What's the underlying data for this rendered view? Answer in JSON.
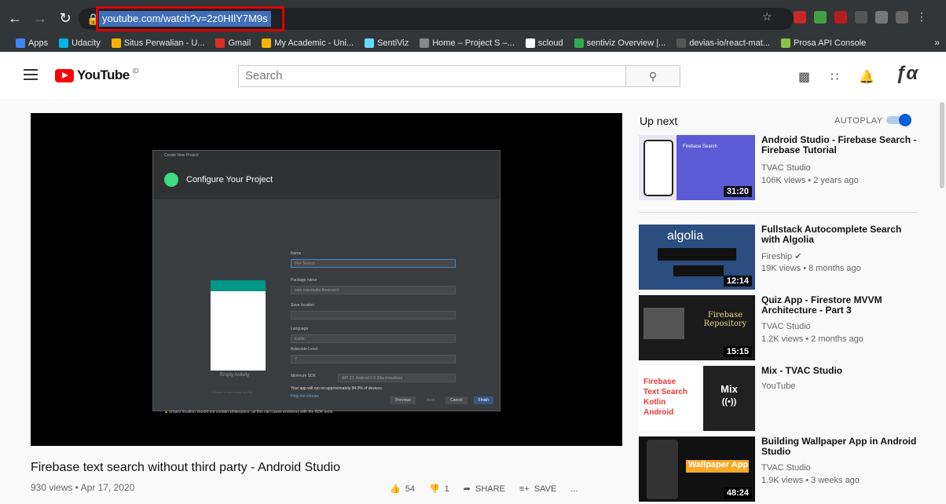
{
  "browser": {
    "url": "youtube.com/watch?v=2z0HIlY7M9s",
    "bookmarks": [
      {
        "label": "Apps",
        "color": "#4285f4"
      },
      {
        "label": "Udacity",
        "color": "#02b3e4"
      },
      {
        "label": "Situs Perwalian - U...",
        "color": "#f4b400"
      },
      {
        "label": "Gmail",
        "color": "#d93025"
      },
      {
        "label": "My Academic - Uni...",
        "color": "#f4b400"
      },
      {
        "label": "SentiViz",
        "color": "#61dafb"
      },
      {
        "label": "Home – Project S –...",
        "color": "#888888"
      },
      {
        "label": "scloud",
        "color": "#ffffff"
      },
      {
        "label": "sentiviz Overview |...",
        "color": "#34a853"
      },
      {
        "label": "devias-io/react-mat...",
        "color": "#555555"
      },
      {
        "label": "Prosa API Console",
        "color": "#8bc34a"
      }
    ],
    "bookmarks_more": "»"
  },
  "header": {
    "logo_text": "YouTube",
    "logo_region": "ID",
    "search_placeholder": "Search"
  },
  "video": {
    "title": "Firebase text search without third party - Android Studio",
    "meta": "930 views • Apr 17, 2020",
    "likes": "54",
    "dislikes": "1",
    "share_label": "SHARE",
    "save_label": "SAVE",
    "more_label": "..."
  },
  "screen_content": {
    "window_title": "Create New Project",
    "dialog_title": "Configure Your Project",
    "name_label": "Name",
    "name_value": "Fire Search",
    "package_label": "Package name",
    "package_value": "com.tvacstudio.firesearch",
    "save_label": "Save location",
    "language_label": "Language",
    "language_value": "Kotlin",
    "bytecode_label": "Bytecode Level",
    "bytecode_value": "7",
    "minsdk_label": "Minimum SDK",
    "minsdk_value": "API 23: Android 6.0 (Marshmallow)",
    "info_text": "Your app will run on approximately 84.9% of devices.",
    "help_text": "Help me choose",
    "template_label": "Empty Activity",
    "template_sub": "Creates a new empty activity",
    "warning": "project location should not contain whitespace, as this can cause problems with the NDK tools.",
    "btn_previous": "Previous",
    "btn_next": "Next",
    "btn_cancel": "Cancel",
    "btn_finish": "Finish"
  },
  "sidebar": {
    "up_next_label": "Up next",
    "autoplay_label": "AUTOPLAY",
    "items": [
      {
        "title": "Android Studio - Firebase Search - Firebase Tutorial",
        "channel": "TVAC Studio",
        "meta": "106K views • 2 years ago",
        "duration": "31:20",
        "thumb_text": "Firebase Search"
      },
      {
        "title": "Fullstack Autocomplete Search with Algolia",
        "channel": "Fireship",
        "meta": "19K views • 8 months ago",
        "duration": "12:14",
        "thumb_text": "algolia"
      },
      {
        "title": "Quiz App - Firestore MVVM Architecture - Part 3",
        "channel": "TVAC Studio",
        "meta": "1.2K views • 2 months ago",
        "duration": "15:15",
        "thumb_text": "Firebase Repository"
      },
      {
        "title": "Mix - TVAC Studio",
        "channel": "YouTube",
        "meta": "",
        "duration": "",
        "thumb_text": "Mix"
      },
      {
        "title": "Building Wallpaper App in Android Studio",
        "channel": "TVAC Studio",
        "meta": "1.9K views • 3 weeks ago",
        "duration": "48:24",
        "thumb_text": "Wallpaper App"
      }
    ]
  }
}
